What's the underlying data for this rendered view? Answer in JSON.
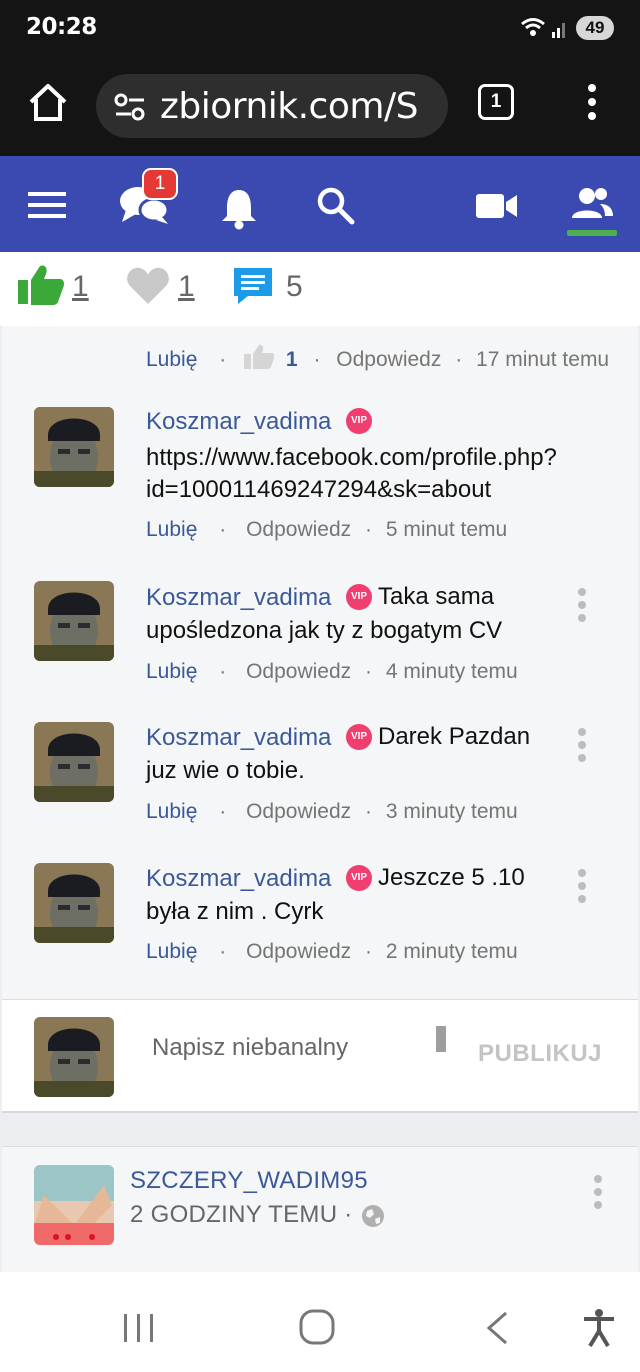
{
  "status_bar": {
    "time": "20:28",
    "battery": "49"
  },
  "browser": {
    "url": "zbiornik.com/S",
    "tab_count": "1"
  },
  "nav": {
    "messages_badge": "1"
  },
  "reactions": {
    "likes": "1",
    "hearts": "1",
    "comments": "5"
  },
  "earlier_comment_meta": {
    "like_label": "Lubię",
    "like_count": "1",
    "reply_label": "Odpowiedz",
    "time": "17 minut temu"
  },
  "comments": [
    {
      "author": "Koszmar_vadima",
      "badge": "VIP",
      "text_line1": "",
      "text_line2": "https://www.facebook.com/profile.php?",
      "text_line3": "id=100011469247294&sk=about",
      "like_label": "Lubię",
      "reply_label": "Odpowiedz",
      "time": "5 minut temu"
    },
    {
      "author": "Koszmar_vadima",
      "badge": "VIP",
      "text_line1": "Taka sama",
      "text_line2": "upośledzona jak ty z bogatym CV",
      "like_label": "Lubię",
      "reply_label": "Odpowiedz",
      "time": "4 minuty temu"
    },
    {
      "author": "Koszmar_vadima",
      "badge": "VIP",
      "text_line1": "Darek Pazdan",
      "text_line2": "juz wie o tobie.",
      "like_label": "Lubię",
      "reply_label": "Odpowiedz",
      "time": "3 minuty temu"
    },
    {
      "author": "Koszmar_vadima",
      "badge": "VIP",
      "text_line1": "Jeszcze 5 .10",
      "text_line2": "była z nim . Cyrk",
      "like_label": "Lubię",
      "reply_label": "Odpowiedz",
      "time": "2 minuty temu"
    }
  ],
  "composer": {
    "placeholder": "Napisz niebanalny",
    "publish_label": "PUBLIKUJ"
  },
  "next_post": {
    "author": "SZCZERY_WADIM95",
    "time": "2 GODZINY TEMU ·"
  },
  "colors": {
    "nav_blue": "#3b4ab0",
    "link_blue": "#3b5998",
    "like_green": "#3aa93a",
    "vip_pink": "#ef3e6f",
    "badge_red": "#e53935"
  }
}
